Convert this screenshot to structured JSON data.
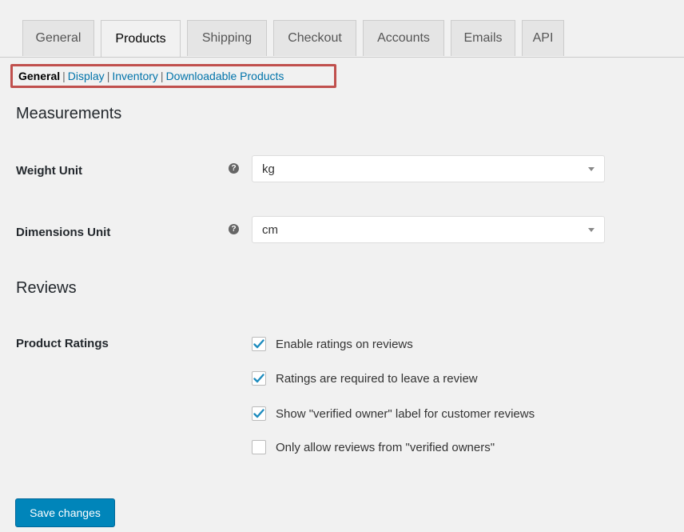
{
  "tabs": [
    {
      "label": "General",
      "active": false
    },
    {
      "label": "Products",
      "active": true
    },
    {
      "label": "Shipping",
      "active": false
    },
    {
      "label": "Checkout",
      "active": false
    },
    {
      "label": "Accounts",
      "active": false
    },
    {
      "label": "Emails",
      "active": false
    },
    {
      "label": "API",
      "active": false
    }
  ],
  "subnav": {
    "current": "General",
    "links": [
      "Display",
      "Inventory",
      "Downloadable Products"
    ],
    "separator": "|"
  },
  "measurements": {
    "heading": "Measurements",
    "weight_label": "Weight Unit",
    "weight_value": "kg",
    "dimensions_label": "Dimensions Unit",
    "dimensions_value": "cm",
    "help_glyph": "?"
  },
  "reviews": {
    "heading": "Reviews",
    "ratings_label": "Product Ratings",
    "options": [
      {
        "label": "Enable ratings on reviews",
        "checked": true
      },
      {
        "label": "Ratings are required to leave a review",
        "checked": true
      },
      {
        "label": "Show \"verified owner\" label for customer reviews",
        "checked": true
      },
      {
        "label": "Only allow reviews from \"verified owners\"",
        "checked": false
      }
    ]
  },
  "save_label": "Save changes",
  "colors": {
    "accent_link": "#0073aa",
    "highlight_border": "#c0504d",
    "primary_button": "#0085ba",
    "checkmark": "#1e8cbe"
  }
}
